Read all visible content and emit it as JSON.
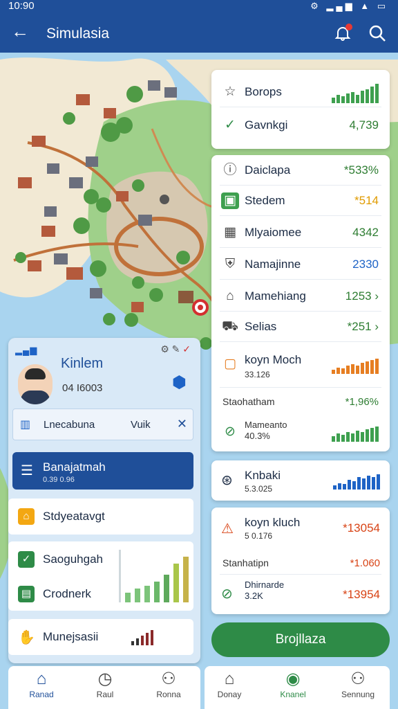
{
  "status": {
    "time": "10:90"
  },
  "appbar": {
    "title": "Simulasia"
  },
  "right_top": [
    {
      "label": "Borops",
      "icon": "star-icon",
      "value": ""
    },
    {
      "label": "Gavnkgi",
      "icon": "check-circle-icon",
      "value": "4,739"
    }
  ],
  "right_list": [
    {
      "label": "Daiclapa",
      "icon": "info-icon",
      "value": "*533%",
      "color": "#2e7d32"
    },
    {
      "label": "Stedem",
      "icon": "building-icon",
      "value": "*514",
      "color": "#e09b00"
    },
    {
      "label": "Mlyaiomee",
      "icon": "grid-icon",
      "value": "4342",
      "color": "#2e7d32"
    },
    {
      "label": "Namajinne",
      "icon": "shield-icon",
      "value": "2330",
      "color": "#1e63c6"
    },
    {
      "label": "Mamehiang",
      "icon": "home-icon",
      "value": "1253 ›",
      "color": "#2e7d32"
    },
    {
      "label": "Selias",
      "icon": "car-icon",
      "value": "*251 ›",
      "color": "#2e7d32"
    }
  ],
  "block_orange": {
    "title": "koyn Moch",
    "sub": "33.126",
    "section": "Staohatham",
    "section_val": "*1,96%",
    "foot_title": "Mameanto",
    "foot_sub": "40.3%"
  },
  "block_blue": {
    "title": "Knbaki",
    "sub": "5.3.025"
  },
  "block_red": {
    "title": "koyn kluch",
    "sub": "5 0.176",
    "value": "*13054",
    "section": "Stanhatipn",
    "section_val": "*1.060",
    "foot_title": "Dhirnarde",
    "foot_sub": "3.2K",
    "foot_val": "*13954"
  },
  "green_button": "Brojllaza",
  "profile": {
    "name": "Kinlem",
    "sub": "04 I6003"
  },
  "profile_row": {
    "label": "Lnecabuna",
    "right": "Vuik"
  },
  "left_menu": {
    "active": "Banajatmah",
    "active_sub": "0.39 0.96",
    "item1": "Stdyeatavgt",
    "item2": "Saoguhgah",
    "item3": "Crodnerk",
    "item4": "Munejsasii"
  },
  "nav_left": [
    {
      "label": "Ranad"
    },
    {
      "label": "Raul"
    },
    {
      "label": "Ronna"
    }
  ],
  "nav_right": [
    {
      "label": "Donay"
    },
    {
      "label": "Knanel"
    },
    {
      "label": "Sennung"
    }
  ],
  "colors": {
    "primary": "#1f4f99",
    "green": "#2e8b47",
    "orange": "#e67e22",
    "blue": "#1e63c6",
    "red": "#d84315"
  }
}
